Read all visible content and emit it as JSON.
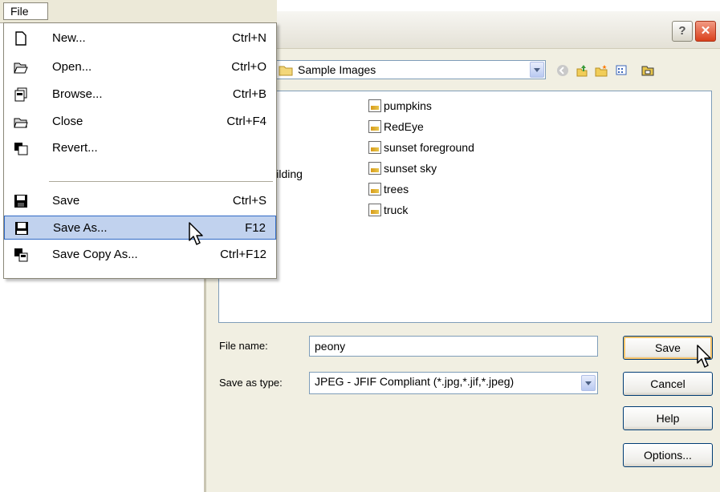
{
  "menubar": {
    "file_label": "File"
  },
  "file_menu": {
    "items": [
      {
        "label": "New...",
        "shortcut": "Ctrl+N",
        "icon": "new-document-icon"
      },
      {
        "label": "Open...",
        "shortcut": "Ctrl+O",
        "icon": "open-folder-icon"
      },
      {
        "label": "Browse...",
        "shortcut": "Ctrl+B",
        "icon": "browse-icon"
      },
      {
        "label": "Close",
        "shortcut": "Ctrl+F4",
        "icon": "close-folder-icon"
      },
      {
        "label": "Revert...",
        "shortcut": "",
        "icon": "revert-icon"
      },
      {
        "label": "Save",
        "shortcut": "Ctrl+S",
        "icon": "floppy-disk-icon"
      },
      {
        "label": "Save As...",
        "shortcut": "F12",
        "icon": "save-as-disk-icon",
        "highlighted": true
      },
      {
        "label": "Save Copy As...",
        "shortcut": "Ctrl+F12",
        "icon": "save-copy-icon"
      }
    ]
  },
  "dialog": {
    "help_glyph": "?",
    "close_glyph": "✕",
    "lookin_folder": "Sample Images",
    "files": [
      {
        "name": "pumpkins"
      },
      {
        "name": "RedEye"
      },
      {
        "name": "sunset foreground"
      },
      {
        "name": "sunset sky"
      },
      {
        "name": "trees"
      },
      {
        "name": "truck"
      }
    ],
    "partial_items": [
      "n building",
      "g"
    ],
    "filename_label": "File name:",
    "filename_value": "peony",
    "savetype_label": "Save as type:",
    "savetype_value": "JPEG - JFIF Compliant (*.jpg,*.jif,*.jpeg)",
    "buttons": {
      "save": "Save",
      "cancel": "Cancel",
      "help": "Help",
      "options": "Options..."
    }
  },
  "colors": {
    "dialog_bg": "#f1efe2",
    "menu_highlight": "#c1d2ee",
    "menu_highlight_border": "#316ac5",
    "close_button": "#d9401c"
  }
}
